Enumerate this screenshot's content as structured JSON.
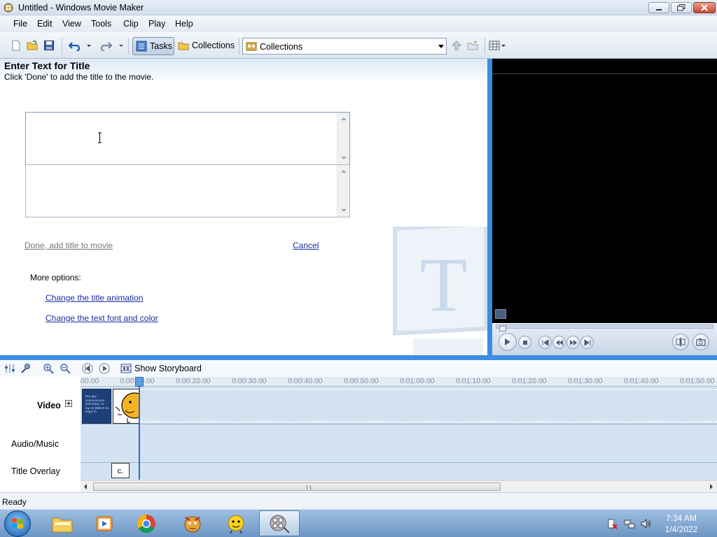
{
  "window": {
    "title": "Untitled - Windows Movie Maker"
  },
  "menu": [
    "File",
    "Edit",
    "View",
    "Tools",
    "Clip",
    "Play",
    "Help"
  ],
  "toolbar": {
    "tasks_label": "Tasks",
    "collections_label": "Collections",
    "collection_combo_value": "Collections"
  },
  "task_pane": {
    "heading": "Enter Text for Title",
    "subheading": "Click 'Done' to add the title to the movie.",
    "title_text": "",
    "secondary_text": "",
    "done_link": "Done, add title to movie",
    "cancel_link": "Cancel",
    "more_options_label": "More options:",
    "option_animation": "Change the title animation",
    "option_font": "Change the text font and color"
  },
  "timeline": {
    "storyboard_label": "Show Storyboard",
    "tracks": [
      "Video",
      "Audio/Music",
      "Title Overlay"
    ],
    "ruler_ticks": [
      "00.00",
      "0:00:10.00",
      "0:00:20.00",
      "0:00:30.00",
      "0:00:40.00",
      "0:00:50.00",
      "0:01:00.00",
      "0:01:10.00",
      "0:01:20.00",
      "0:01:30.00",
      "0:01:40.00",
      "0:01:50.00"
    ],
    "clip1_text": "hey guy yoooooooooo and today i w top 10 BBB in so enjoy th",
    "title_clip_label": "c."
  },
  "status": {
    "text": "Ready"
  },
  "taskbar": {
    "time": "7:34 AM",
    "date": "1/4/2022"
  },
  "colors": {
    "accent": "#3a8de0",
    "link": "#1a2fa0",
    "video_track": "#d2e2f0"
  }
}
